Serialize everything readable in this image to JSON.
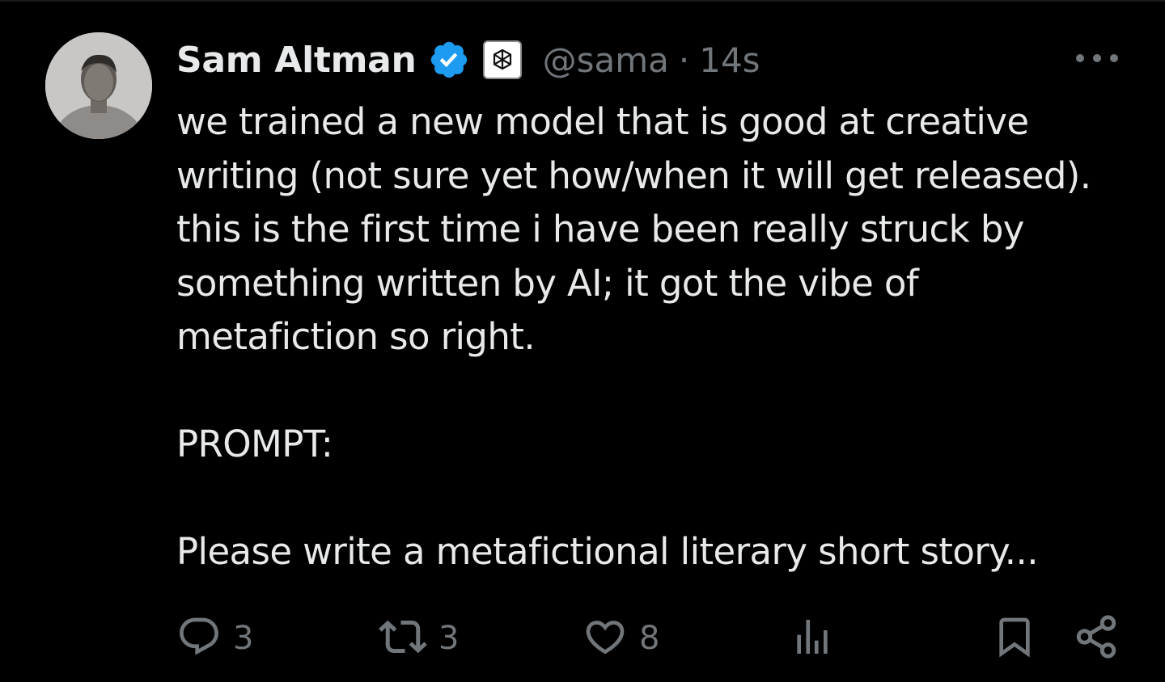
{
  "post": {
    "author_name": "Sam Altman",
    "handle": "@sama",
    "separator": "·",
    "timestamp": "14s",
    "text": "we trained a new model that is good at creative writing (not sure yet how/when it will get released). this is the first time i have been really struck by something written by AI; it got the vibe of metafiction so right.\n\nPROMPT:\n\nPlease write a metafictional literary short story..."
  },
  "actions": {
    "replies": "3",
    "reposts": "3",
    "likes": "8"
  },
  "icons": {
    "verified": "verified-badge-icon",
    "affiliate": "openai-logo-icon",
    "more": "more-options-icon",
    "reply": "reply-icon",
    "repost": "repost-icon",
    "like": "heart-icon",
    "views": "analytics-icon",
    "bookmark": "bookmark-icon",
    "share": "share-icon"
  },
  "colors": {
    "background": "#000000",
    "text_primary": "#e7e9ea",
    "text_secondary": "#71767b",
    "verified_blue": "#1d9bf0"
  }
}
